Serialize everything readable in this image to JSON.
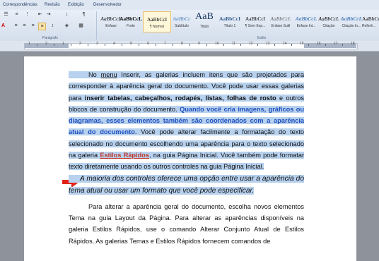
{
  "ribbon": {
    "tabs": [
      "Correspondências",
      "Revisão",
      "Exibição",
      "Desenvolvedor"
    ],
    "paragraph_group_label": "Parágrafo",
    "styles_group_label": "Estilo",
    "styles": [
      {
        "preview": "AaBbCcL",
        "name": "Ênfase"
      },
      {
        "preview": "AaBbCcL",
        "name": "Forte"
      },
      {
        "preview": "AaBbCcI",
        "name": "¶ Normal"
      },
      {
        "preview": "AaBbCc",
        "name": "Subtítulo"
      },
      {
        "preview": "AaB",
        "name": "Título"
      },
      {
        "preview": "AaBbCcI",
        "name": "Título 1"
      },
      {
        "preview": "AaBbCcI",
        "name": "¶ Sem Esp..."
      },
      {
        "preview": "AaBbCcL",
        "name": "Ênfase Sutil"
      },
      {
        "preview": "AaBbCcL",
        "name": "Ênfase Int..."
      },
      {
        "preview": "AaBbCcL",
        "name": "Citação"
      },
      {
        "preview": "AaBbCcL",
        "name": "Citação In..."
      },
      {
        "preview": "AaBbCc",
        "name": "Referê..."
      }
    ],
    "active_style_index": 2
  },
  "ruler": {
    "numbers": [
      "1",
      "2",
      "1",
      "2",
      "3",
      "4",
      "5",
      "6",
      "7",
      "8",
      "9",
      "10",
      "11",
      "12",
      "13",
      "14",
      "15",
      "16",
      "17",
      "18"
    ]
  },
  "document": {
    "p1": {
      "t1": "No ",
      "menu": "menu",
      "t2": " Inserir, as galerias incluem itens que são projetados para corresponder à aparência geral do documento. Você pode usar essas galerias para ",
      "bold": "inserir tabelas, cabeçalhos, rodapés, listas, folhas de rosto",
      "t3": " e outros blocos de construção do documento. ",
      "blue": "Quando você cria imagens, gráficos ou diagramas, esses elementos também são coordenados com a aparência atual do documento",
      "t4": ". Você pode alterar facilmente a formatação do texto selecionado no documento escolhendo uma aparência para o texto selecionado na galeria ",
      "red": "Estilos Rápidos",
      "t5": ", na guia Página Inicial. Você também pode formatar texto diretamente usando os outros controles na guia Página Inicial."
    },
    "p2": "A maioria dos controles oferece uma opção entre usar a aparência do tema atual ou usar um formato que você pode especificar.",
    "p3": "Para alterar a aparência geral do documento, escolha novos elementos Tema na guia Layout da Página. Para alterar as aparências disponíveis na galeria Estilos Rápidos, use o comando Alterar Conjunto Atual de Estilos Rápidos. As galerias Temas e Estilos Rápidos fornecem comandos de",
    "arrow_color": "#e2231a",
    "selection_color": "#b7d1ee"
  }
}
